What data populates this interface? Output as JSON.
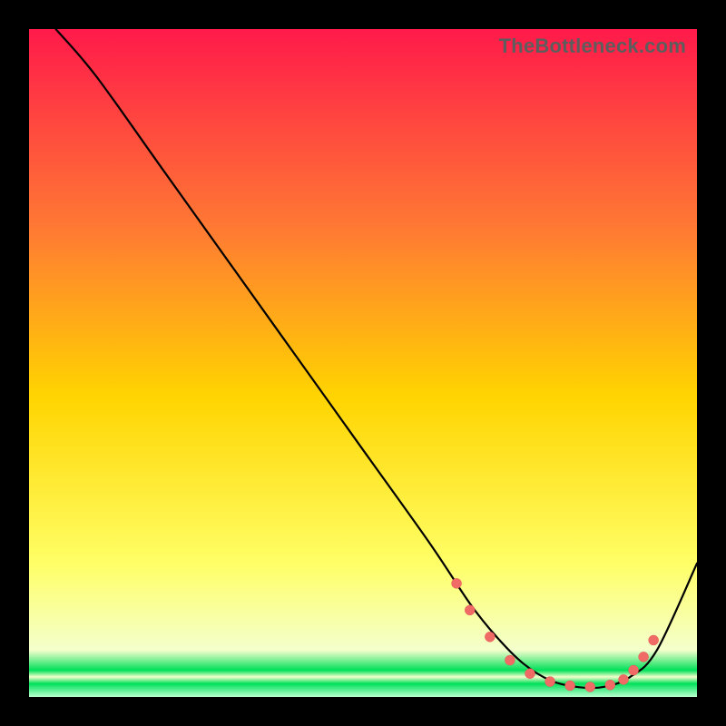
{
  "watermark": {
    "text": "TheBottleneck.com"
  },
  "colors": {
    "gradient_top": "#ff1a4a",
    "gradient_mid1": "#ff7a33",
    "gradient_mid2": "#ffd400",
    "gradient_mid3": "#ffff66",
    "gradient_mid4": "#f4ffcc",
    "gradient_bottom_accent": "#00e05a",
    "curve": "#000000",
    "marker_fill": "#f06a66",
    "marker_stroke": "#e65a56"
  },
  "chart_data": {
    "type": "line",
    "title": "",
    "xlabel": "",
    "ylabel": "",
    "xlim": [
      0,
      100
    ],
    "ylim": [
      0,
      100
    ],
    "series": [
      {
        "name": "bottleneck-curve",
        "x": [
          4,
          10,
          20,
          30,
          40,
          50,
          60,
          66,
          70,
          74,
          78,
          82,
          86,
          90,
          94,
          100
        ],
        "y": [
          100,
          93,
          79,
          65,
          51,
          37,
          23,
          14,
          9,
          5,
          2.5,
          1.5,
          1.5,
          3,
          7,
          20
        ]
      }
    ],
    "markers": {
      "series": "bottleneck-curve",
      "points": [
        {
          "x": 64,
          "y": 17
        },
        {
          "x": 66,
          "y": 13
        },
        {
          "x": 69,
          "y": 9
        },
        {
          "x": 72,
          "y": 5.5
        },
        {
          "x": 75,
          "y": 3.5
        },
        {
          "x": 78,
          "y": 2.3
        },
        {
          "x": 81,
          "y": 1.7
        },
        {
          "x": 84,
          "y": 1.5
        },
        {
          "x": 87,
          "y": 1.8
        },
        {
          "x": 89,
          "y": 2.6
        },
        {
          "x": 90.5,
          "y": 4
        },
        {
          "x": 92,
          "y": 6
        },
        {
          "x": 93.5,
          "y": 8.5
        }
      ]
    },
    "annotations": []
  }
}
